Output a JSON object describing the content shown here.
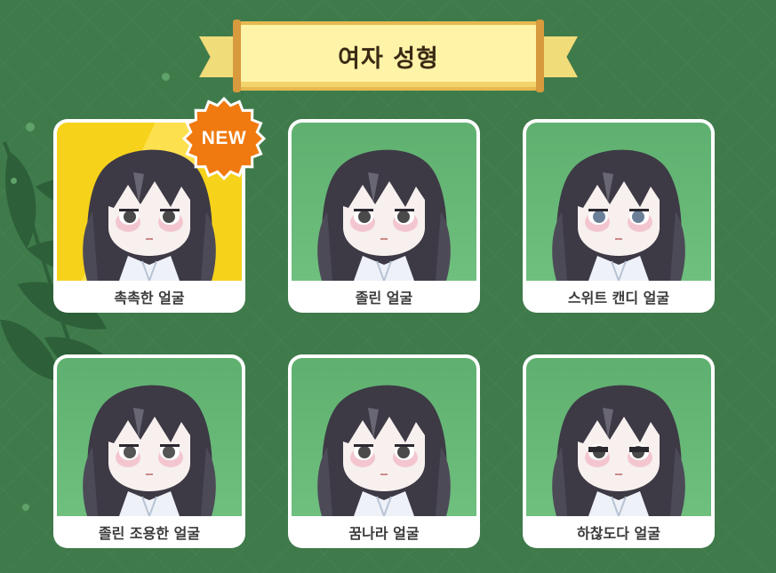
{
  "page_title": "여자 성형",
  "new_badge": "NEW",
  "colors": {
    "background": "#3f7a4b",
    "banner": "#fff3a8",
    "card_bg_green": "#6fbf7e",
    "card_bg_yellow": "#f6d21a",
    "badge": "#f07a10"
  },
  "faces": [
    {
      "label": "촉촉한 얼굴",
      "icon": "character-portrait-icon",
      "bg": "yellow",
      "is_new": true
    },
    {
      "label": "졸린 얼굴",
      "icon": "character-portrait-icon",
      "bg": "green",
      "is_new": false
    },
    {
      "label": "스위트 캔디 얼굴",
      "icon": "character-portrait-icon",
      "bg": "green",
      "is_new": false
    },
    {
      "label": "졸린 조용한 얼굴",
      "icon": "character-portrait-icon",
      "bg": "green",
      "is_new": false
    },
    {
      "label": "꿈나라 얼굴",
      "icon": "character-portrait-icon",
      "bg": "green",
      "is_new": false
    },
    {
      "label": "하찮도다 얼굴",
      "icon": "character-portrait-icon",
      "bg": "green",
      "is_new": false
    }
  ]
}
